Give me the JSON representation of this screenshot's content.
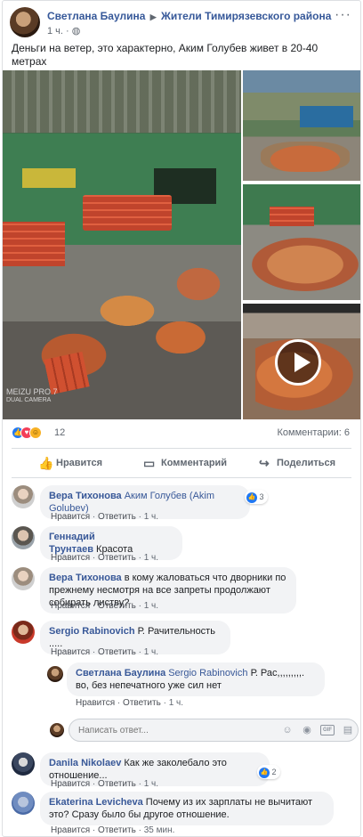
{
  "post": {
    "author": "Светлана Баулина",
    "separator": "▶",
    "group": "Жители Тимирязевского района",
    "time": "1 ч.",
    "privacy_icon": "globe-icon",
    "text": "Деньги на ветер, это характерно, Аким Голубев живет в 20-40 метрах",
    "watermark_model": "MEIZU PRO 7",
    "watermark_sub": "DUAL CAMERA"
  },
  "stats": {
    "reaction_count": "12",
    "comments": "Комментарии: 6"
  },
  "actions": {
    "like": "Нравится",
    "comment": "Комментарий",
    "share": "Поделиться"
  },
  "comments": [
    {
      "name": "Вера Тихонова",
      "text": "Аким Голубев (Akim Golubev)",
      "text_is_tag": true,
      "like": "Нравится",
      "reply": "Ответить",
      "time": "1 ч.",
      "reactions": "3"
    },
    {
      "name": "Геннадий Трунтаев",
      "text": "Красота",
      "like": "Нравится",
      "reply": "Ответить",
      "time": "1 ч."
    },
    {
      "name": "Вера Тихонова",
      "text": "в кому жаловаться что дворники по прежнему несмотря на все запреты продолжают собирать листву?",
      "like": "Нравится",
      "reply": "Ответить",
      "time": "1 ч."
    },
    {
      "name": "Sergio Rabinovich",
      "text": "Р. Рачительность .....",
      "like": "Нравится",
      "reply": "Ответить",
      "time": "1 ч."
    },
    {
      "name": "Светлана Баулина",
      "tag": "Sergio Rabinovich",
      "text": "Р. Рас,,,,,,,,,. во, без непечатного уже сил нет",
      "like": "Нравится",
      "reply": "Ответить",
      "time": "1 ч."
    },
    {
      "name": "Danila Nikolaev",
      "text": "Как же заколебало это отношение...",
      "like": "Нравится",
      "reply": "Ответить",
      "time": "1 ч.",
      "reactions": "2"
    },
    {
      "name": "Ekaterina Levicheva",
      "text": "Почему из их зарплаты не вычитают это? Сразу было бы другое отношение.",
      "like": "Нравится",
      "reply": "Ответить",
      "time": "35 мин."
    }
  ],
  "reply_box": {
    "placeholder": "Написать ответ..."
  },
  "separator_dot": "·"
}
